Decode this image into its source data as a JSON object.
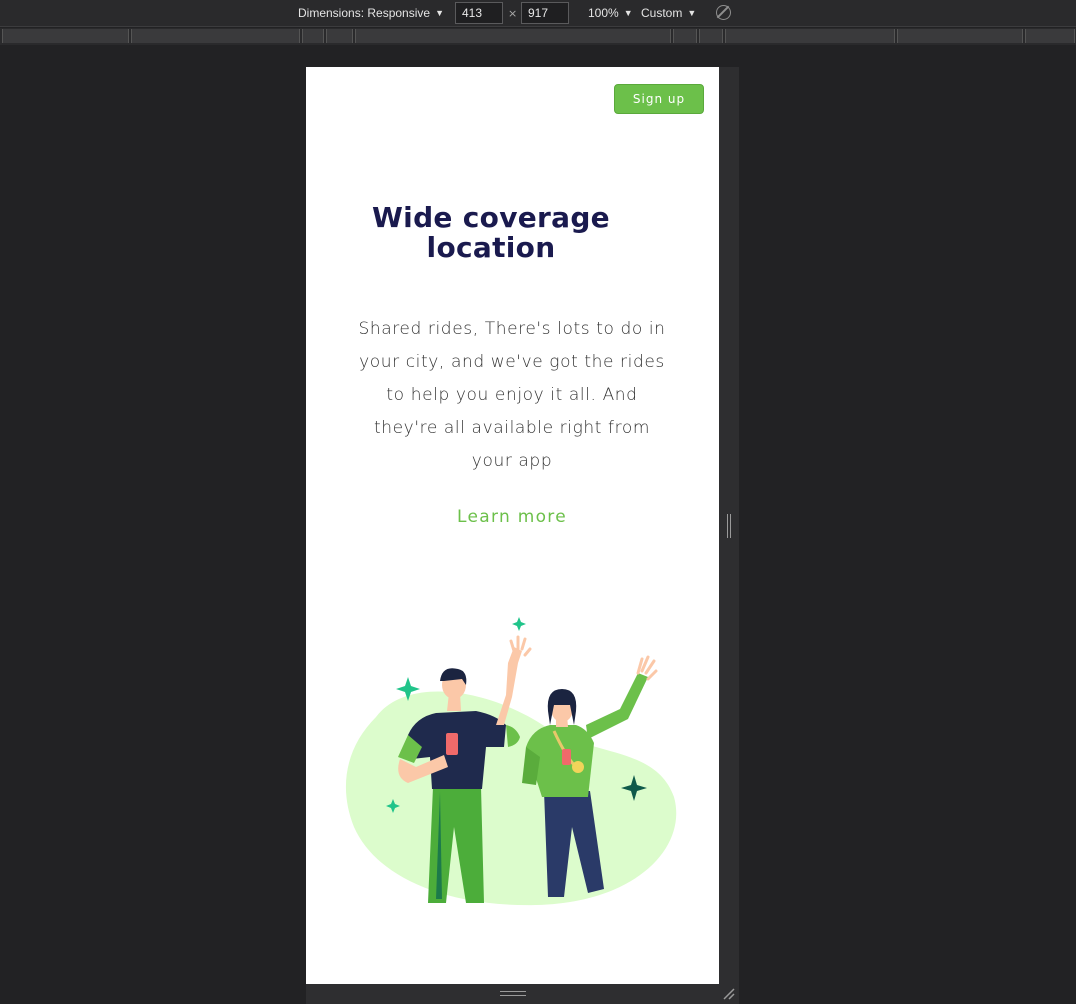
{
  "devtools": {
    "dimensions_label": "Dimensions: Responsive",
    "width_value": "413",
    "times": "×",
    "height_value": "917",
    "zoom": "100%",
    "throttle": "Custom"
  },
  "page": {
    "signup_label": "Sign up",
    "title": "Wide coverage location",
    "description": "Shared rides, There's lots to do in your city, and we've got the rides to help you enjoy it all. And they're all available right from your app",
    "learn_more": "Learn more"
  },
  "colors": {
    "accent": "#6cc04a",
    "title": "#1a1a4e",
    "blob": "#dcfccc",
    "sparkle": "#20c48a"
  },
  "icons": [
    "chevron-down-icon",
    "rotate-icon",
    "resize-handle-icon",
    "person-illustration"
  ]
}
